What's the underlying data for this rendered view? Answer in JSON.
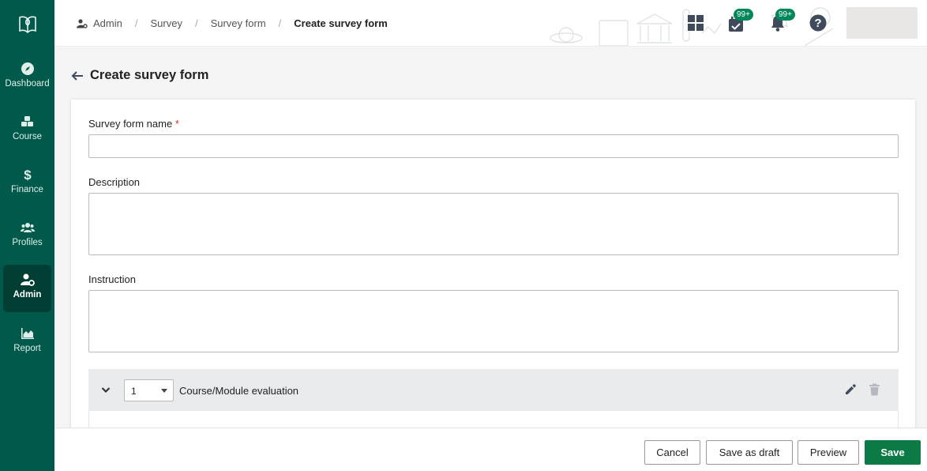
{
  "sidebar": {
    "items": [
      {
        "label": "Dashboard",
        "icon": "compass-icon"
      },
      {
        "label": "Course",
        "icon": "cubes-icon"
      },
      {
        "label": "Finance",
        "icon": "dollar-icon"
      },
      {
        "label": "Profiles",
        "icon": "users-icon"
      },
      {
        "label": "Admin",
        "icon": "user-gear-icon",
        "active": true
      },
      {
        "label": "Report",
        "icon": "area-chart-icon"
      }
    ]
  },
  "header": {
    "breadcrumb": [
      "Admin",
      "Survey",
      "Survey form",
      "Create survey form"
    ],
    "tasks_badge": "99+",
    "notifications_badge": "99+"
  },
  "page": {
    "title": "Create survey form"
  },
  "form": {
    "name_label": "Survey form name",
    "required_mark": "*",
    "name_value": "",
    "description_label": "Description",
    "description_value": "",
    "instruction_label": "Instruction",
    "instruction_value": ""
  },
  "section": {
    "order_value": "1",
    "title": "Course/Module evaluation"
  },
  "footer": {
    "cancel_label": "Cancel",
    "draft_label": "Save as draft",
    "preview_label": "Preview",
    "save_label": "Save"
  },
  "colors": {
    "sidebar": "#00594a",
    "sidebar_active": "#003d32",
    "primary": "#0b7a45",
    "badge": "#00875a"
  }
}
